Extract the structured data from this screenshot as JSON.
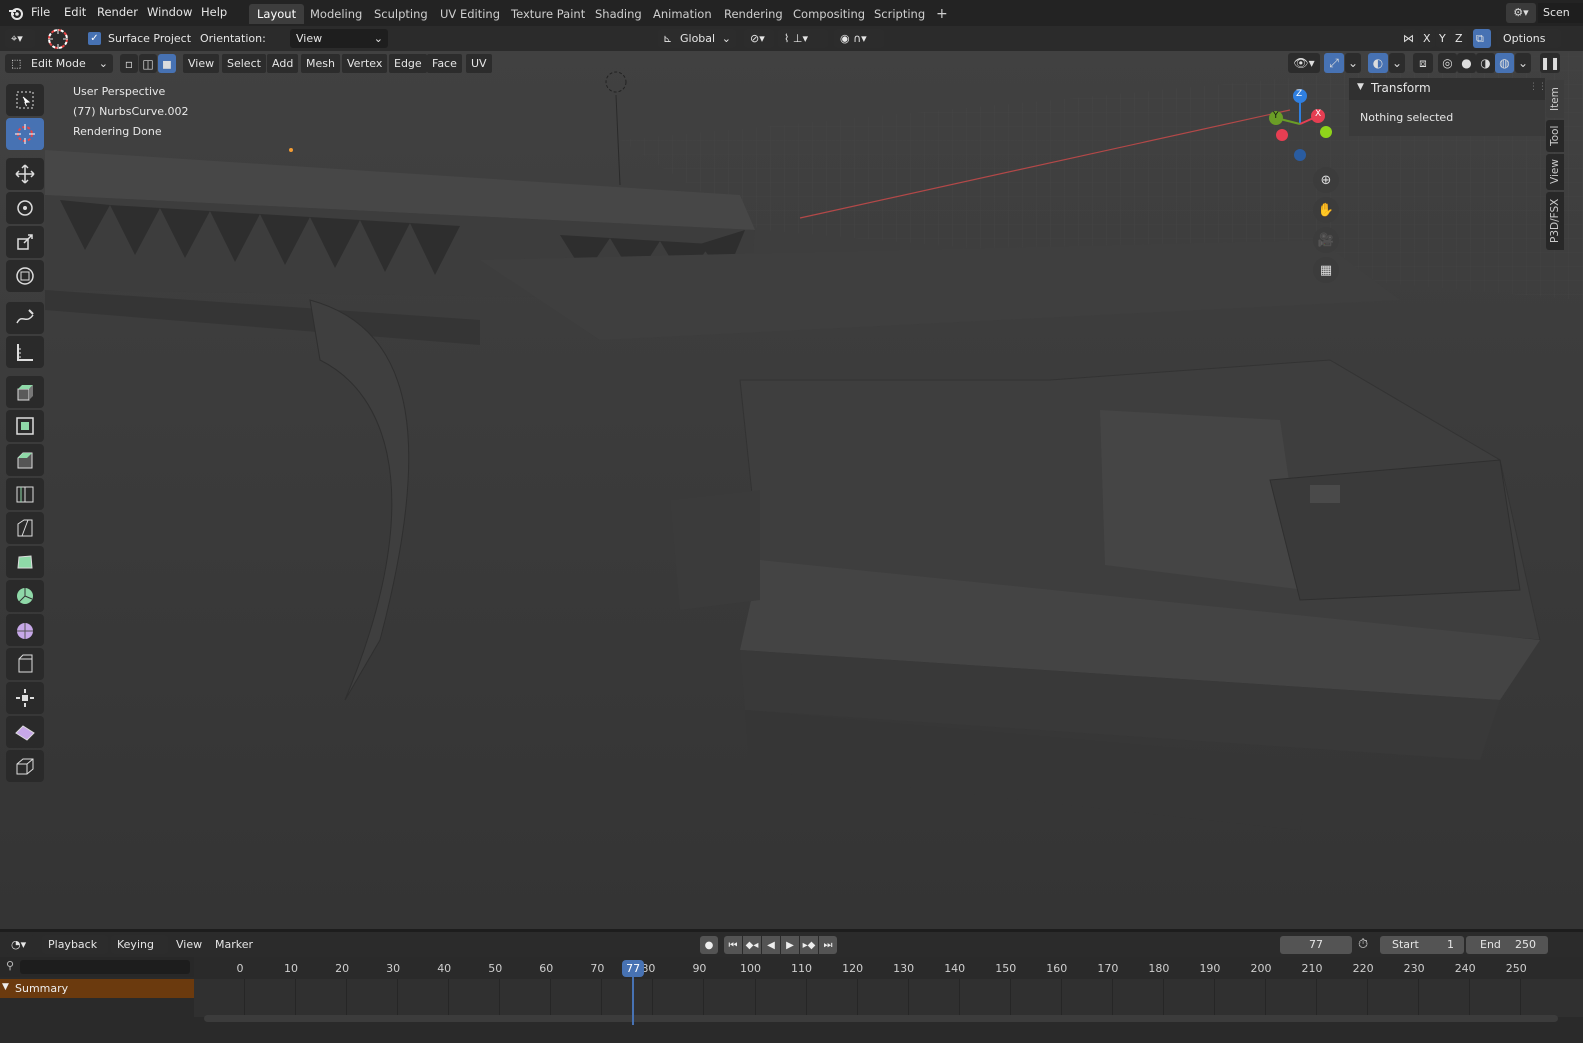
{
  "topbar": {
    "menus": [
      "File",
      "Edit",
      "Render",
      "Window",
      "Help"
    ],
    "workspace_tabs": [
      "Layout",
      "Modeling",
      "Sculpting",
      "UV Editing",
      "Texture Paint",
      "Shading",
      "Animation",
      "Rendering",
      "Compositing",
      "Scripting"
    ],
    "active_tab": "Layout",
    "add_tab": "+",
    "scene_label": "Scen"
  },
  "toolheader": {
    "surface_project_label": "Surface Project",
    "surface_project_checked": true,
    "orientation_label": "Orientation:",
    "orientation_value": "View",
    "transform_orientation": "Global",
    "axes": [
      "X",
      "Y",
      "Z"
    ],
    "options_label": "Options"
  },
  "viewheader": {
    "mode": "Edit Mode",
    "menus": [
      "View",
      "Select",
      "Add",
      "Mesh",
      "Vertex",
      "Edge",
      "Face",
      "UV"
    ]
  },
  "viewport": {
    "perspective": "User Perspective",
    "object_info": "(77) NurbsCurve.002",
    "status": "Rendering Done"
  },
  "gizmo": {
    "x": "X",
    "y": "Y",
    "z": "Z"
  },
  "npanel": {
    "section_title": "Transform",
    "empty_message": "Nothing selected",
    "tabs": [
      "Item",
      "Tool",
      "View",
      "P3D/FSX"
    ]
  },
  "timeline": {
    "menus": [
      "Playback",
      "Keying",
      "View",
      "Marker"
    ],
    "current_frame": "77",
    "start_label": "Start",
    "start_value": "1",
    "end_label": "End",
    "end_value": "250",
    "ticks": [
      "0",
      "10",
      "20",
      "30",
      "40",
      "50",
      "60",
      "70",
      "80",
      "90",
      "100",
      "110",
      "120",
      "130",
      "140",
      "150",
      "160",
      "170",
      "180",
      "190",
      "200",
      "210",
      "220",
      "230",
      "240",
      "250"
    ],
    "playhead_label": "77",
    "summary_label": "Summary"
  },
  "colors": {
    "accent": "#4772b3",
    "x_axis": "#e63e52",
    "y_axis": "#6a9d26",
    "z_axis": "#2f7fe0",
    "summary": "#6b3a0e"
  }
}
